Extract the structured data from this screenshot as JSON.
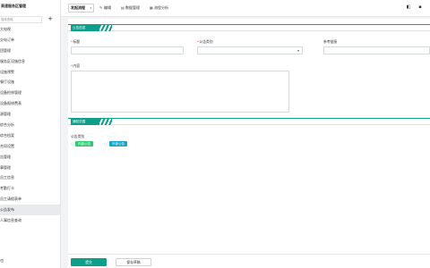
{
  "sidebar": {
    "title": "高速服务区管理",
    "search_placeholder": "搜索表格",
    "add_label": "+",
    "items": [
      {
        "label": "大电视"
      },
      {
        "label": "交电订单"
      },
      {
        "label": "团管理"
      },
      {
        "label": "服务区设施信息"
      },
      {
        "label": "设施预警"
      },
      {
        "label": "餐厅设施"
      },
      {
        "label": "设备检修管理"
      },
      {
        "label": "设备报修费表"
      },
      {
        "label": "源管理"
      },
      {
        "label": "综合分析"
      },
      {
        "label": "综合档案"
      },
      {
        "label": "合同设置"
      },
      {
        "label": "告管理"
      },
      {
        "label": "事管理"
      },
      {
        "label": "员工信息"
      },
      {
        "label": "考勤打卡"
      },
      {
        "label": "员工请假表单"
      },
      {
        "label": "公告发布"
      },
      {
        "label": "人事信息查询"
      }
    ],
    "active_index": 17,
    "footer": "也"
  },
  "topbar": {
    "view_select": "发起流程",
    "caret": "▾",
    "edit_label": "编辑",
    "data_label": "数据管理",
    "flow_label": "流程分析",
    "edit_icon": "pencil-icon",
    "data_icon": "table-icon",
    "flow_icon": "chart-icon"
  },
  "form": {
    "section1_title": "公告信息",
    "title_label": "标题",
    "category_label": "公告类别",
    "ref_label": "参考链接",
    "content_label": "内容",
    "section2_title": "通知范围",
    "category_field_label": "公告类别",
    "tag_internal": "内部公告",
    "tag_external": "外部公告",
    "tag_sep": "○",
    "submit_label": "提交",
    "save_draft_label": "保存草稿"
  }
}
